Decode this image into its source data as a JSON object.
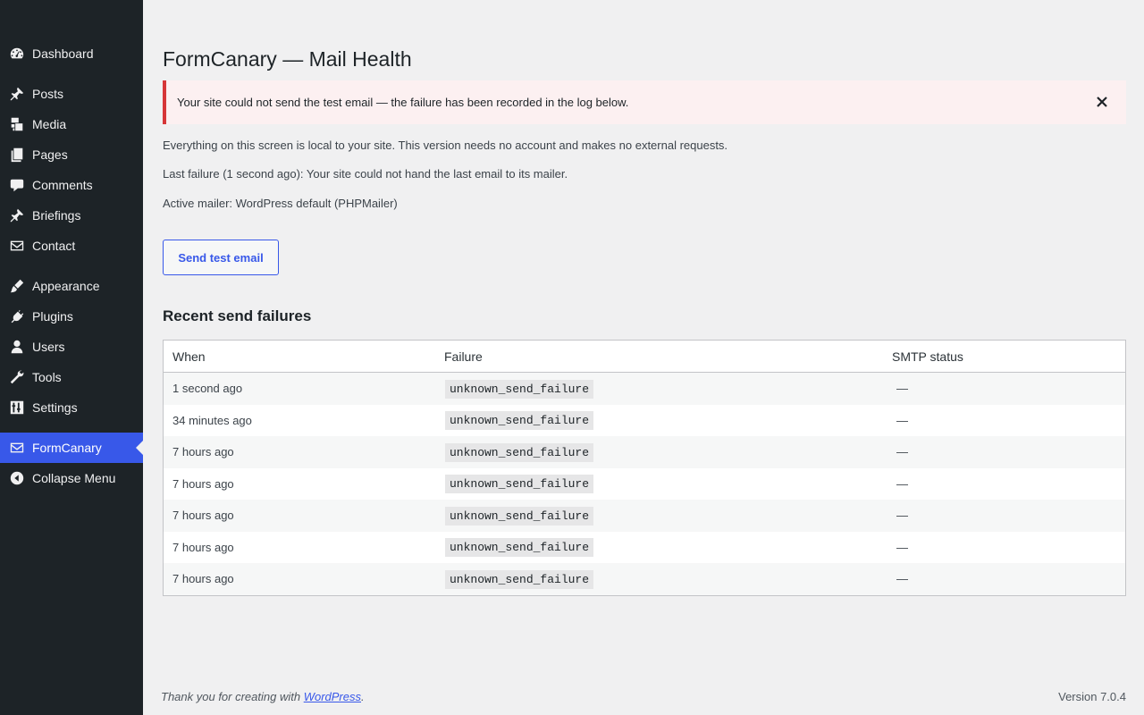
{
  "sidebar": {
    "items": [
      {
        "label": "Dashboard",
        "icon": "dashboard-icon"
      },
      {
        "label": "Posts",
        "icon": "pin-icon"
      },
      {
        "label": "Media",
        "icon": "media-icon"
      },
      {
        "label": "Pages",
        "icon": "pages-icon"
      },
      {
        "label": "Comments",
        "icon": "comment-icon"
      },
      {
        "label": "Briefings",
        "icon": "pin-icon"
      },
      {
        "label": "Contact",
        "icon": "envelope-icon"
      },
      {
        "label": "Appearance",
        "icon": "brush-icon"
      },
      {
        "label": "Plugins",
        "icon": "plug-icon"
      },
      {
        "label": "Users",
        "icon": "user-icon"
      },
      {
        "label": "Tools",
        "icon": "wrench-icon"
      },
      {
        "label": "Settings",
        "icon": "sliders-icon"
      },
      {
        "label": "FormCanary",
        "icon": "envelope-icon"
      },
      {
        "label": "Collapse Menu",
        "icon": "collapse-arrow-icon"
      }
    ]
  },
  "page": {
    "title": "FormCanary — Mail Health",
    "notice": "Your site could not send the test email — the failure has been recorded in the log below.",
    "para1": "Everything on this screen is local to your site. This version needs no account and makes no external requests.",
    "para2": "Last failure (1 second ago): Your site could not hand the last email to its mailer.",
    "para3": "Active mailer: WordPress default (PHPMailer)",
    "button": "Send test email",
    "section_title": "Recent send failures"
  },
  "table": {
    "headers": [
      "When",
      "Failure",
      "SMTP status"
    ],
    "rows": [
      {
        "when": "1 second ago",
        "failure": "unknown_send_failure",
        "smtp": "—"
      },
      {
        "when": "34 minutes ago",
        "failure": "unknown_send_failure",
        "smtp": "—"
      },
      {
        "when": "7 hours ago",
        "failure": "unknown_send_failure",
        "smtp": "—"
      },
      {
        "when": "7 hours ago",
        "failure": "unknown_send_failure",
        "smtp": "—"
      },
      {
        "when": "7 hours ago",
        "failure": "unknown_send_failure",
        "smtp": "—"
      },
      {
        "when": "7 hours ago",
        "failure": "unknown_send_failure",
        "smtp": "—"
      },
      {
        "when": "7 hours ago",
        "failure": "unknown_send_failure",
        "smtp": "—"
      }
    ]
  },
  "footer": {
    "thanks_prefix": "Thank you for creating with ",
    "thanks_link": "WordPress",
    "thanks_suffix": ".",
    "version": "Version 7.0.4"
  },
  "colors": {
    "sidebar_bg": "#1d2327",
    "accent": "#3858e9",
    "error": "#d63638",
    "notice_bg": "#fcf0f1"
  }
}
